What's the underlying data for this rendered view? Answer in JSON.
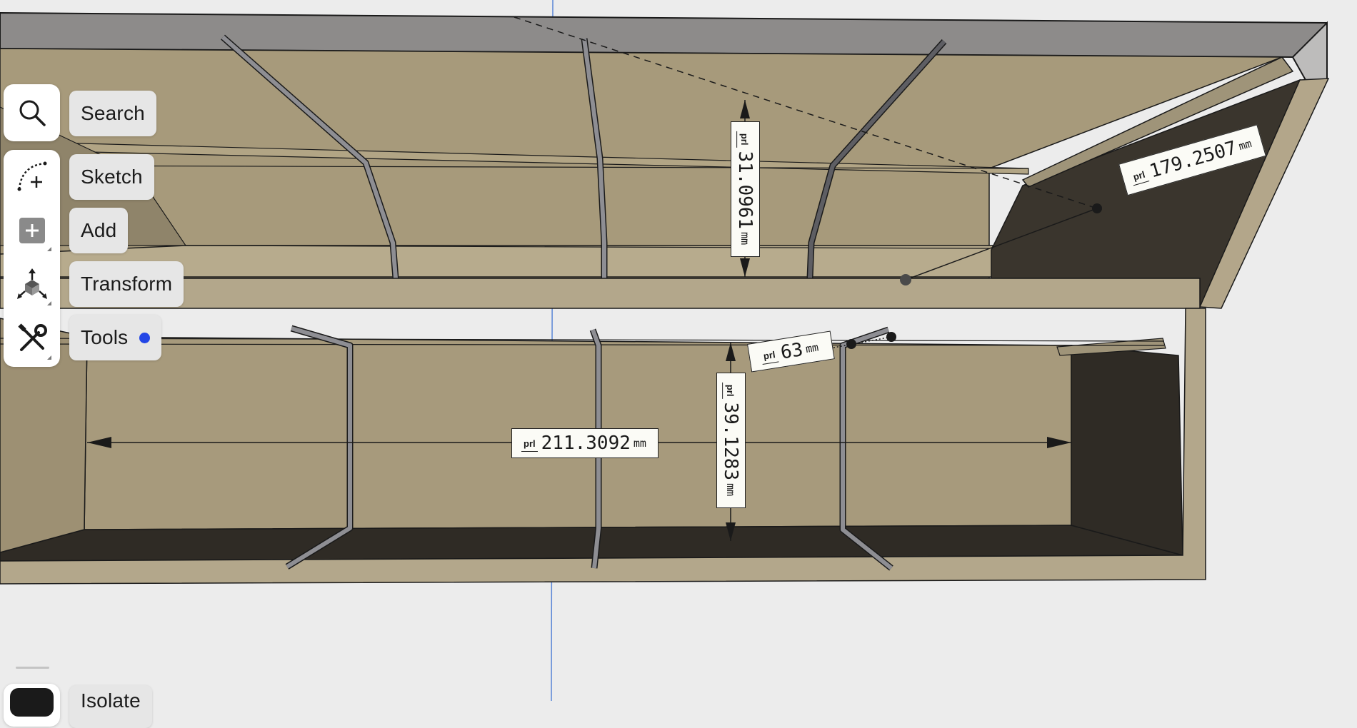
{
  "toolbar": {
    "search_label": "Search",
    "sketch_label": "Sketch",
    "add_label": "Add",
    "transform_label": "Transform",
    "tools_label": "Tools",
    "isolate_label": "Isolate",
    "icons": [
      "search-icon",
      "sketch-icon",
      "add-icon",
      "transform-icon",
      "tools-icon",
      "isolate-icon"
    ]
  },
  "dimensions": {
    "upper_height": {
      "tag": "prl",
      "value": "31.0961",
      "unit": "mm"
    },
    "diagonal": {
      "tag": "prl",
      "value": "179.2507",
      "unit": "mm"
    },
    "width": {
      "tag": "prl",
      "value": "211.3092",
      "unit": "mm"
    },
    "lower_height": {
      "tag": "prl",
      "value": "39.1283",
      "unit": "mm"
    },
    "small": {
      "tag": "prl",
      "value": "63",
      "unit": "mm"
    }
  },
  "colors": {
    "accent_dot": "#2346e6",
    "model_face": "#a99c7e",
    "model_dark": "#2f2b25",
    "axis_line": "#5a86d6"
  }
}
